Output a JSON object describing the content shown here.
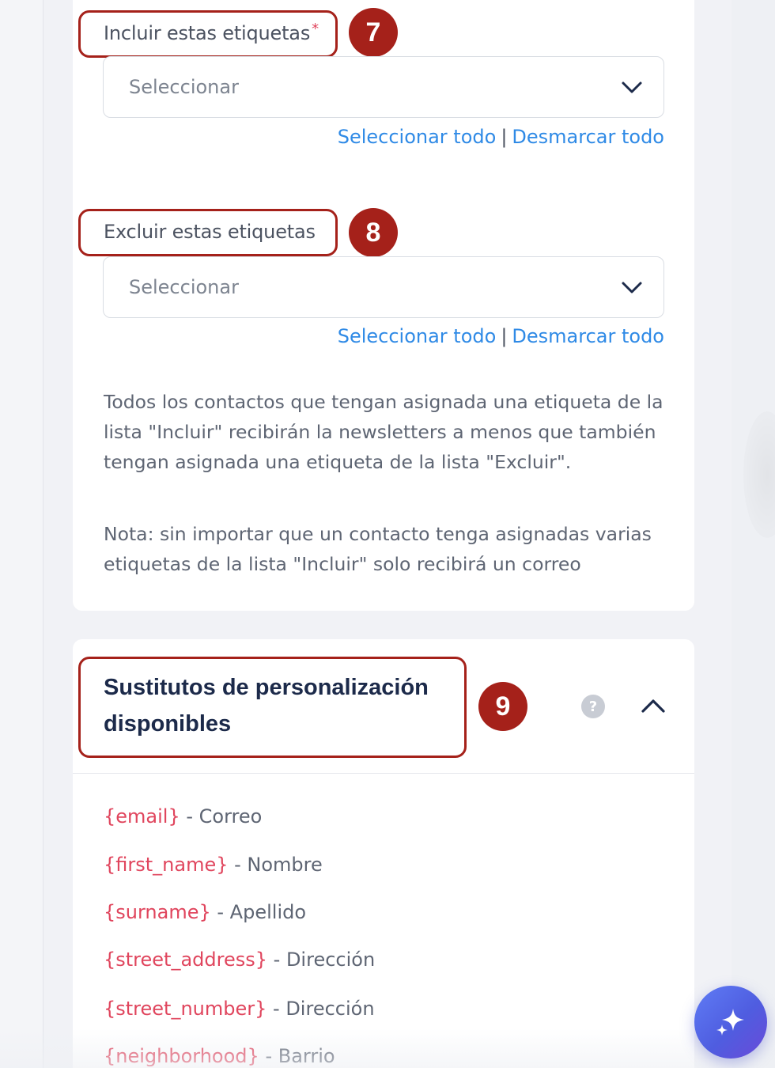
{
  "include_tags": {
    "label": "Incluir estas etiquetas",
    "required_mark": "*",
    "step_badge": "7",
    "select_placeholder": "Seleccionar",
    "select_all": "Seleccionar todo",
    "separator": "|",
    "deselect_all": "Desmarcar todo"
  },
  "exclude_tags": {
    "label": "Excluir estas etiquetas",
    "step_badge": "8",
    "select_placeholder": "Seleccionar",
    "select_all": "Seleccionar todo",
    "separator": "|",
    "deselect_all": "Desmarcar todo"
  },
  "info_text": {
    "paragraph": "Todos los contactos que tengan asignada una etiqueta de la lista \"Incluir\" recibirán la newsletters a menos que también tengan asignada una etiqueta de la lista \"Excluir\".",
    "note": "Nota: sin importar que un contacto tenga asignadas varias etiquetas de la lista \"Incluir\" solo recibirá un correo"
  },
  "substitutes": {
    "title": "Sustitutos de personalización disponibles",
    "step_badge": "9",
    "help_glyph": "?",
    "items": [
      {
        "token": "{email}",
        "desc": " - Correo"
      },
      {
        "token": "{first_name}",
        "desc": " - Nombre"
      },
      {
        "token": "{surname}",
        "desc": " - Apellido"
      },
      {
        "token": "{street_address}",
        "desc": " - Dirección"
      },
      {
        "token": "{street_number}",
        "desc": " - Dirección"
      },
      {
        "token": "{neighborhood}",
        "desc": " - Barrio"
      }
    ]
  },
  "icons": {
    "dropdown": "chevron-down-icon",
    "collapse": "chevron-up-icon",
    "help": "question-icon",
    "ai": "sparkles-icon"
  },
  "colors": {
    "accent_link": "#2f8ae6",
    "token_red": "#e0455d",
    "highlight_red": "#a5211a",
    "title_navy": "#1c2a4a"
  }
}
